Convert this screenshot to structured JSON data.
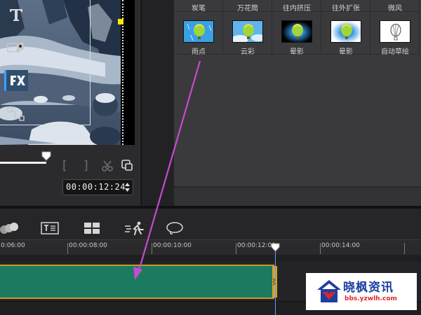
{
  "preview": {
    "timecode": "00:00:12:24"
  },
  "toolbar_icons": [
    "text-icon",
    "filter-graphic-icon",
    "fx-icon",
    "path-icon"
  ],
  "library": {
    "top_row": [
      {
        "label": "炭笔"
      },
      {
        "label": "万花筒"
      },
      {
        "label": "往内挤压"
      },
      {
        "label": "往外扩张"
      },
      {
        "label": "微风"
      }
    ],
    "effects": [
      {
        "label": "雨点",
        "thumb": "balloon-blue-sky"
      },
      {
        "label": "云彩",
        "thumb": "balloon-sky-clouds"
      },
      {
        "label": "晕影",
        "thumb": "balloon-dark-vignette"
      },
      {
        "label": "晕影",
        "thumb": "balloon-light-vignette"
      },
      {
        "label": "自动草绘",
        "thumb": "balloon-sketch"
      }
    ]
  },
  "timeline": {
    "ruler_labels": [
      "0:06:00",
      "00:00:08:00",
      "00:00:10:00",
      "00:00:12:00",
      "00:00:14:00"
    ],
    "tool_icons": [
      "multi-track-icon",
      "title-track-icon",
      "grid-icon",
      "motion-icon",
      "lasso-icon"
    ]
  },
  "colors": {
    "clip": "#1b7a5f",
    "clip_border": "#c99b22",
    "arrow": "#c44bd0",
    "fx_highlight": "#3aa0ff"
  },
  "watermark": {
    "name": "晓枫资讯",
    "url": "bbs.yzwlh.com"
  }
}
